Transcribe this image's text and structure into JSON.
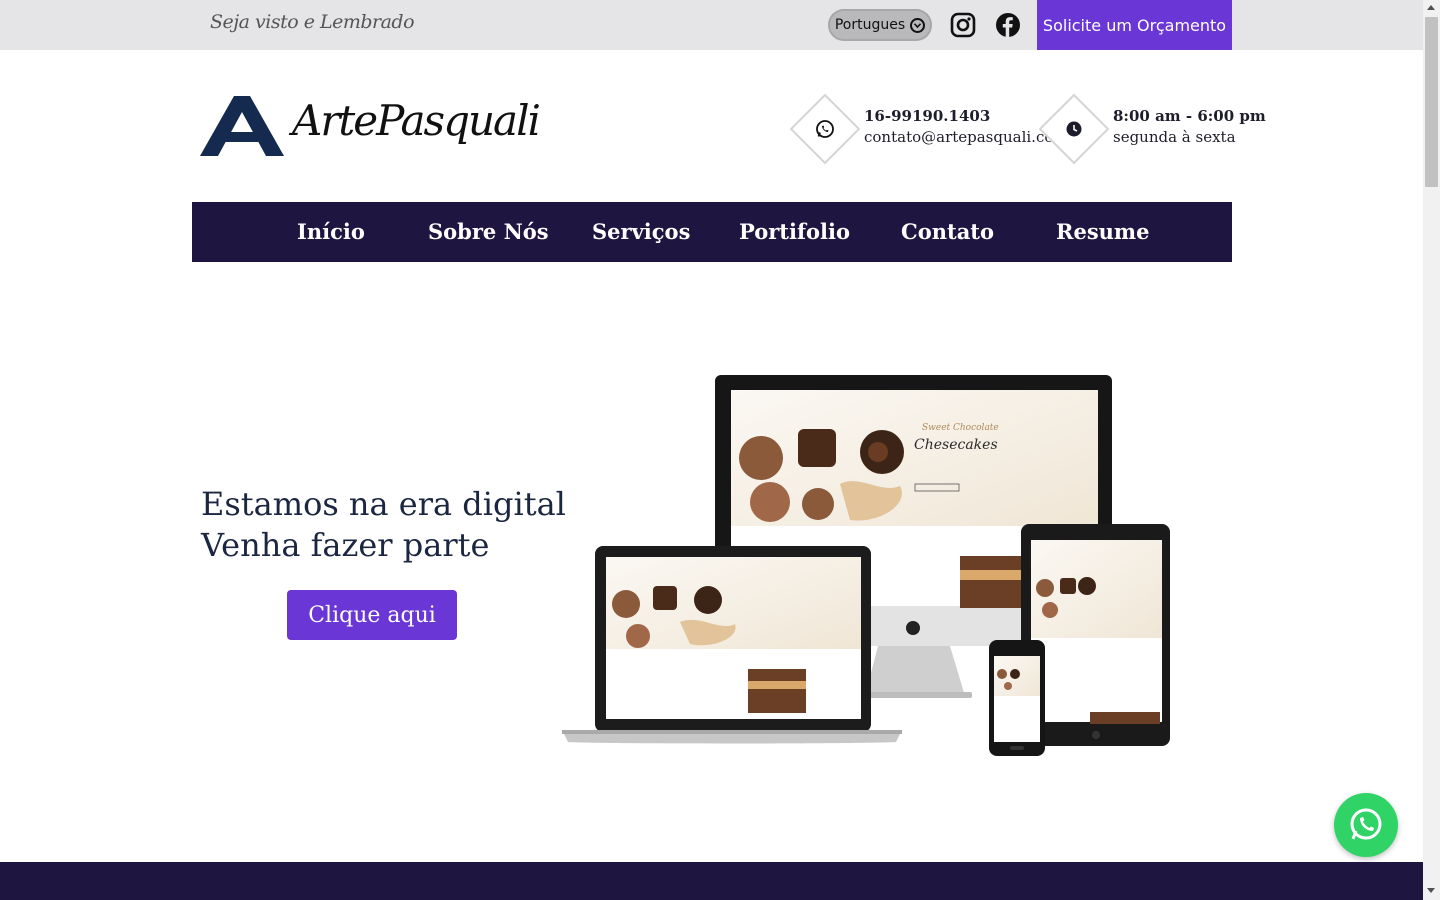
{
  "topbar": {
    "tagline": "Seja visto e Lembrado",
    "language": "Portugues",
    "cta": "Solicite um Orçamento"
  },
  "header": {
    "logo_text": "ArtePasquali",
    "phone": "16-99190.1403",
    "email": "contato@artepasquali.com",
    "hours": "8:00 am - 6:00 pm",
    "days": "segunda à sexta"
  },
  "nav": {
    "items": [
      "Início",
      "Sobre Nós",
      "Serviços",
      "Portifolio",
      "Contato",
      "Resume"
    ]
  },
  "hero": {
    "line1": "Estamos na era digital",
    "line2": "Venha fazer parte",
    "button": "Clique aqui"
  },
  "mockup": {
    "heading_small": "Sweet Chocolate",
    "heading_large": "Chesecakes"
  },
  "colors": {
    "accent": "#6a36d6",
    "navy": "#1f1541",
    "whatsapp": "#2fd366"
  },
  "icons": {
    "language_dropdown": "chevron-circle-icon",
    "instagram": "instagram-icon",
    "facebook": "facebook-icon",
    "phone": "whatsapp-icon",
    "hours": "clock-icon",
    "floating": "whatsapp-icon"
  }
}
